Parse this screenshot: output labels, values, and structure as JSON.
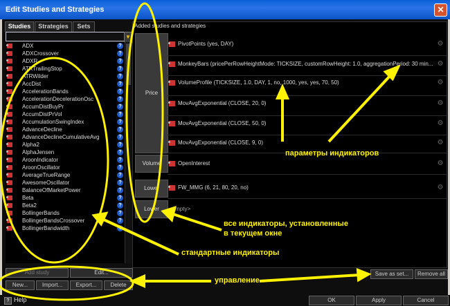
{
  "window": {
    "title": "Edit Studies and Strategies",
    "close_glyph": "✕"
  },
  "tabs": [
    {
      "label": "Studies",
      "active": true
    },
    {
      "label": "Strategies",
      "active": false
    },
    {
      "label": "Sets",
      "active": false
    }
  ],
  "studies": [
    "ADX",
    "ADXCrossover",
    "ADXR",
    "ATRTrailingStop",
    "ATRWilder",
    "AccDist",
    "AccelerationBands",
    "AccelerationDecelerationOsc",
    "AccumDistBuyPr",
    "AccumDistPrVol",
    "AccumulationSwingIndex",
    "AdvanceDecline",
    "AdvanceDeclineCumulativeAvg",
    "Alpha2",
    "AlphaJensen",
    "AroonIndicator",
    "AroonOscillator",
    "AverageTrueRange",
    "AwesomeOscillator",
    "BalanceOfMarketPower",
    "Beta",
    "Beta2",
    "BollingerBands",
    "BollingerBandsCrossover",
    "BollingerBandwidth"
  ],
  "left_buttons": {
    "add_study": "Add study",
    "edit": "Edit...",
    "new": "New...",
    "import": "Import...",
    "export": "Export...",
    "delete": "Delete"
  },
  "right": {
    "header": "Added studies and strategies",
    "panels": {
      "price": "Price",
      "volume": "Volume",
      "lower1": "Lower",
      "lower2": "Lower"
    },
    "price_studies": [
      "PivotPoints (yes, DAY)",
      "MonkeyBars (pricePerRowHeightMode: TICKSIZE, customRowHeight: 1.0, aggregationPeriod: 30 min...",
      "VolumeProfile (TICKSIZE, 1.0, DAY, 1, no, 1000, yes, yes, 70, 50)",
      "MovAvgExponential (CLOSE, 20, 0)",
      "MovAvgExponential (CLOSE, 50, 0)",
      "MovAvgExponential (CLOSE, 9, 0)"
    ],
    "volume_studies": [
      "OpenInterest"
    ],
    "lower1_studies": [
      "FW_MMG (6, 21, 80, 20, no)"
    ],
    "lower2_empty": "<empty>"
  },
  "right_buttons": {
    "save_as_set": "Save as set...",
    "remove_all": "Remove all"
  },
  "footer": {
    "help": "Help",
    "ok": "OK",
    "apply": "Apply",
    "cancel": "Cancel"
  },
  "annotations": {
    "params": "параметры индикаторов",
    "installed_line1": "все индикаторы, установленные",
    "installed_line2": "в текущем окне",
    "standard": "стандартные индикаторы",
    "control": "управление"
  },
  "colors": {
    "annotation": "#fff200",
    "titlebar": "#0a5fd8",
    "study_icon": "#cc3333"
  }
}
